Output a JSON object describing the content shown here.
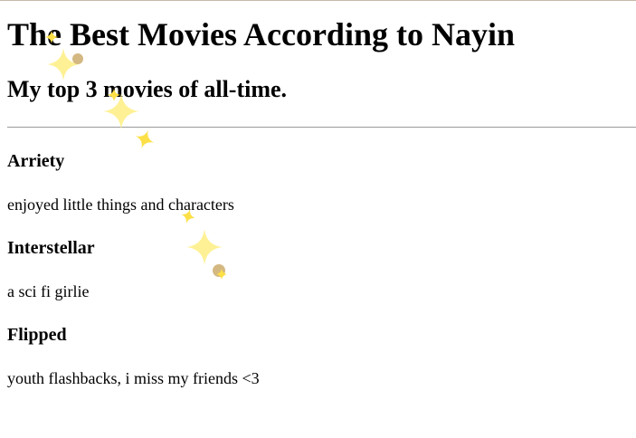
{
  "page": {
    "title": "The Best Movies According to Nayin",
    "subtitle": "My top 3 movies of all-time."
  },
  "movies": [
    {
      "title": "Arriety",
      "description": "enjoyed little things and characters"
    },
    {
      "title": "Interstellar",
      "description": "a sci fi girlie"
    },
    {
      "title": "Flipped",
      "description": "youth flashbacks, i miss my friends <3"
    }
  ],
  "decor": {
    "sparkle_color": "#fde047",
    "sparkle_light_color": "#fef08a",
    "dot_color": "#d4b882"
  }
}
